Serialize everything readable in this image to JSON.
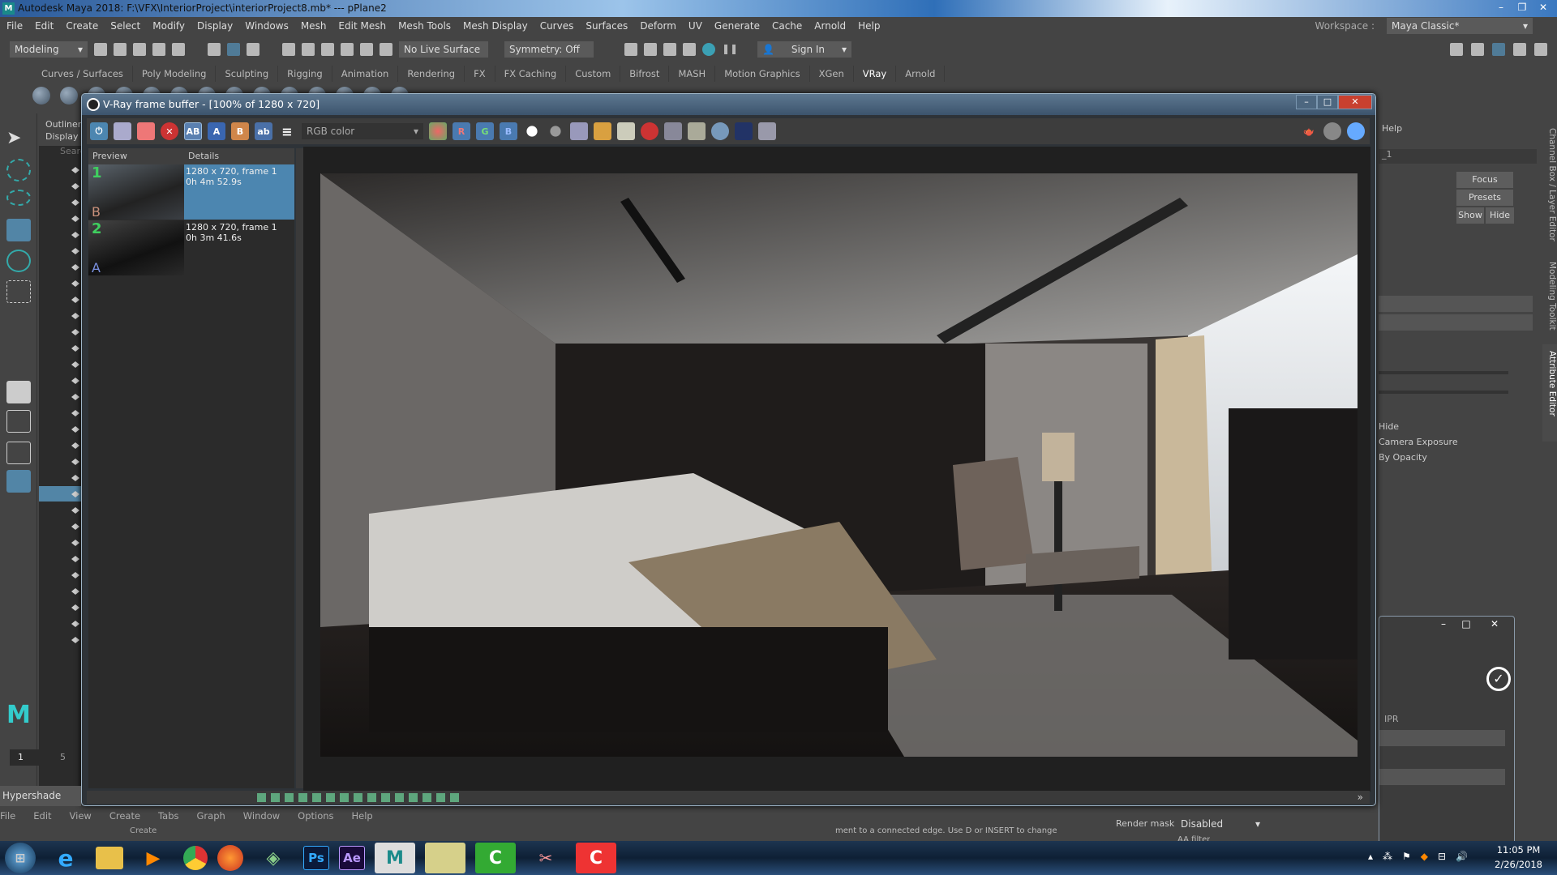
{
  "window": {
    "title": "Autodesk Maya 2018: F:\\VFX\\InteriorProject\\interiorProject8.mb*  ---  pPlane2",
    "app_icon": "M"
  },
  "menu": [
    "File",
    "Edit",
    "Create",
    "Select",
    "Modify",
    "Display",
    "Windows",
    "Mesh",
    "Edit Mesh",
    "Mesh Tools",
    "Mesh Display",
    "Curves",
    "Surfaces",
    "Deform",
    "UV",
    "Generate",
    "Cache",
    "Arnold",
    "Help"
  ],
  "statusline": {
    "mode": "Modeling",
    "live_surface": "No Live Surface",
    "symmetry": "Symmetry: Off",
    "sign_in": "Sign In",
    "workspace_label": "Workspace :",
    "workspace": "Maya Classic*"
  },
  "shelf_tabs": [
    "Curves / Surfaces",
    "Poly Modeling",
    "Sculpting",
    "Rigging",
    "Animation",
    "Rendering",
    "FX",
    "FX Caching",
    "Custom",
    "Bifrost",
    "MASH",
    "Motion Graphics",
    "XGen",
    "VRay",
    "Arnold"
  ],
  "shelf_active": "VRay",
  "outliner": {
    "title": "Outliner",
    "menu": "Display",
    "search_placeholder": "Search..."
  },
  "vfb": {
    "title": "V-Ray frame buffer - [100% of 1280 x 720]",
    "channel": "RGB color",
    "toolbar_letters": {
      "a": "A",
      "b": "B",
      "r": "R",
      "g": "G",
      "bl": "B"
    },
    "history_headers": [
      "Preview",
      "Details"
    ],
    "history": [
      {
        "num": "1",
        "slot": "B",
        "line1": "1280 x 720, frame 1",
        "line2": "0h 4m 52.9s",
        "selected": true
      },
      {
        "num": "2",
        "slot": "A",
        "line1": "1280 x 720, frame 1",
        "line2": "0h 3m 41.6s",
        "selected": false
      }
    ]
  },
  "right_panel": {
    "help": "Help",
    "field": "_1",
    "focus": "Focus",
    "presets": "Presets",
    "show": "Show",
    "hide": "Hide",
    "opt1": "Hide",
    "opt2": "Camera Exposure",
    "opt3": "By Opacity",
    "tabs": [
      "Channel Box / Layer Editor",
      "Modeling Toolkit",
      "Attribute Editor"
    ]
  },
  "timeline": {
    "frame": "1",
    "tick": "5"
  },
  "hypershade": {
    "title": "Hypershade",
    "menu": [
      "File",
      "Edit",
      "View",
      "Create",
      "Tabs",
      "Graph",
      "Window",
      "Options",
      "Help"
    ],
    "create": "Create"
  },
  "render_settings": {
    "ipr": "IPR",
    "render_mask_label": "Render mask",
    "render_mask": "Disabled",
    "aa_filter": "AA filter"
  },
  "help_line": "ment to a connected edge. Use D or INSERT to change",
  "taskbar": {
    "apps": [
      "windows-start",
      "internet-explorer",
      "file-explorer",
      "media-player",
      "chrome",
      "firefox",
      "sketchup",
      "Ps",
      "Ae",
      "M",
      "sticky-notes",
      "camtasia-c",
      "snipping-tool",
      "camtasia-recorder"
    ],
    "time": "11:05 PM",
    "date": "2/26/2018"
  },
  "colors": {
    "accent": "#5285a6",
    "vfb_title": "#4a657f",
    "close": "#c8402f"
  }
}
